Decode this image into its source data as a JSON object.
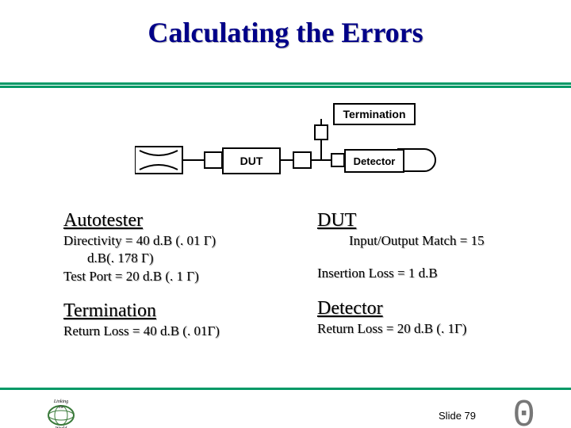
{
  "title": "Calculating the Errors",
  "diagram": {
    "termination": "Termination",
    "dut": "DUT",
    "detector": "Detector"
  },
  "autotester": {
    "heading": "Autotester",
    "directivity": "Directivity = 40 d.B (. 01 Γ)",
    "directivity_sub": "d.B(. 178 Γ)",
    "test_port": "Test Port = 20 d.B (. 1 Γ)"
  },
  "dut": {
    "heading": "DUT",
    "io_match": "Input/Output Match = 15",
    "insertion_loss": "Insertion Loss = 1 d.B"
  },
  "termination": {
    "heading": "Termination",
    "return_loss": "Return Loss = 40 d.B (. 01Γ)"
  },
  "detector": {
    "heading": "Detector",
    "return_loss": "Return Loss = 20 d.B (. 1Γ)"
  },
  "slide_label": "Slide 79",
  "corner_digit": "0"
}
